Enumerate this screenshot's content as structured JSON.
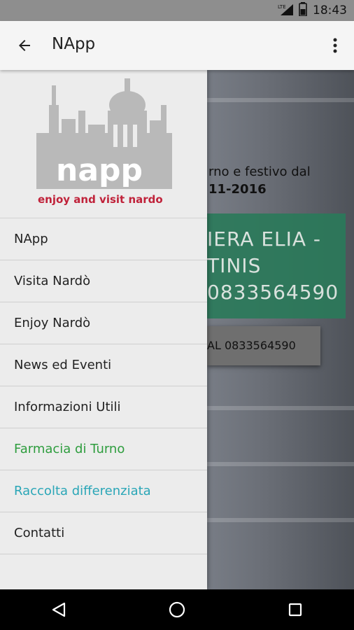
{
  "status_bar": {
    "time": "18:43",
    "network": "LTE"
  },
  "app_bar": {
    "title": "NApp"
  },
  "drawer": {
    "logo_text": "napp",
    "logo_tagline": "enjoy and visit nardo",
    "items": [
      {
        "label": "NApp"
      },
      {
        "label": "Visita Nardò"
      },
      {
        "label": "Enjoy Nardò"
      },
      {
        "label": "News ed Eventi"
      },
      {
        "label": "Informazioni Utili"
      },
      {
        "label": "Farmacia di Turno",
        "color": "#2e9d3e"
      },
      {
        "label": "Raccolta differenziata",
        "color": "#2aa6b7"
      },
      {
        "label": "Contatti"
      }
    ]
  },
  "background": {
    "text_line1": "rno e festivo dal",
    "text_line2": "11-2016",
    "pharmacy_name_1": "IERA ELIA -",
    "pharmacy_name_2": "TINIS",
    "pharmacy_phone": "0833564590",
    "call_button": "AL 0833564590"
  }
}
